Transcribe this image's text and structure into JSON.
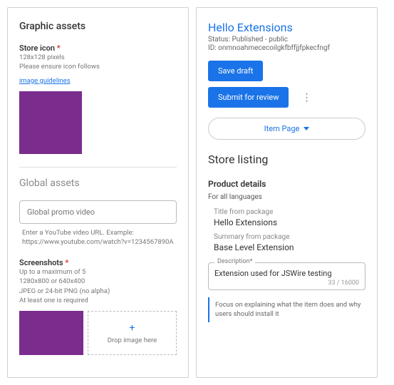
{
  "left": {
    "graphic_assets_title": "Graphic assets",
    "store_icon": {
      "label": "Store icon",
      "dims": "128x128 pixels",
      "ensure": "Please ensure icon follows",
      "link": "image guidelines"
    },
    "global_assets_title": "Global assets",
    "promo_video": {
      "placeholder": "Global promo video",
      "help": "Enter a YouTube video URL. Example: https://www.youtube.com/watch?v=1234567890A"
    },
    "screenshots": {
      "label": "Screenshots",
      "l1": "Up to a maximum of 5",
      "l2": "1280x800 or 640x400",
      "l3": "JPEG or 24-bit PNG (no alpha)",
      "l4": "At least one is required",
      "drop": "Drop image here"
    }
  },
  "right": {
    "title": "Hello Extensions",
    "status": "Status: Published - public",
    "id": "ID: onmnoahmececoilgkfbffjjfpkecfngf",
    "save_draft": "Save draft",
    "submit": "Submit for review",
    "item_page": "Item Page",
    "store_listing": "Store listing",
    "product_details": "Product details",
    "for_all": "For all languages",
    "title_from_pkg_label": "Title from package",
    "title_from_pkg_val": "Hello Extensions",
    "summary_label": "Summary from package",
    "summary_val": "Base Level Extension",
    "desc_label": "Description*",
    "desc_val": "Extension used for JSWire testing",
    "desc_counter": "33 / 16000",
    "desc_help": "Focus on explaining what the item does and why users should install it"
  }
}
